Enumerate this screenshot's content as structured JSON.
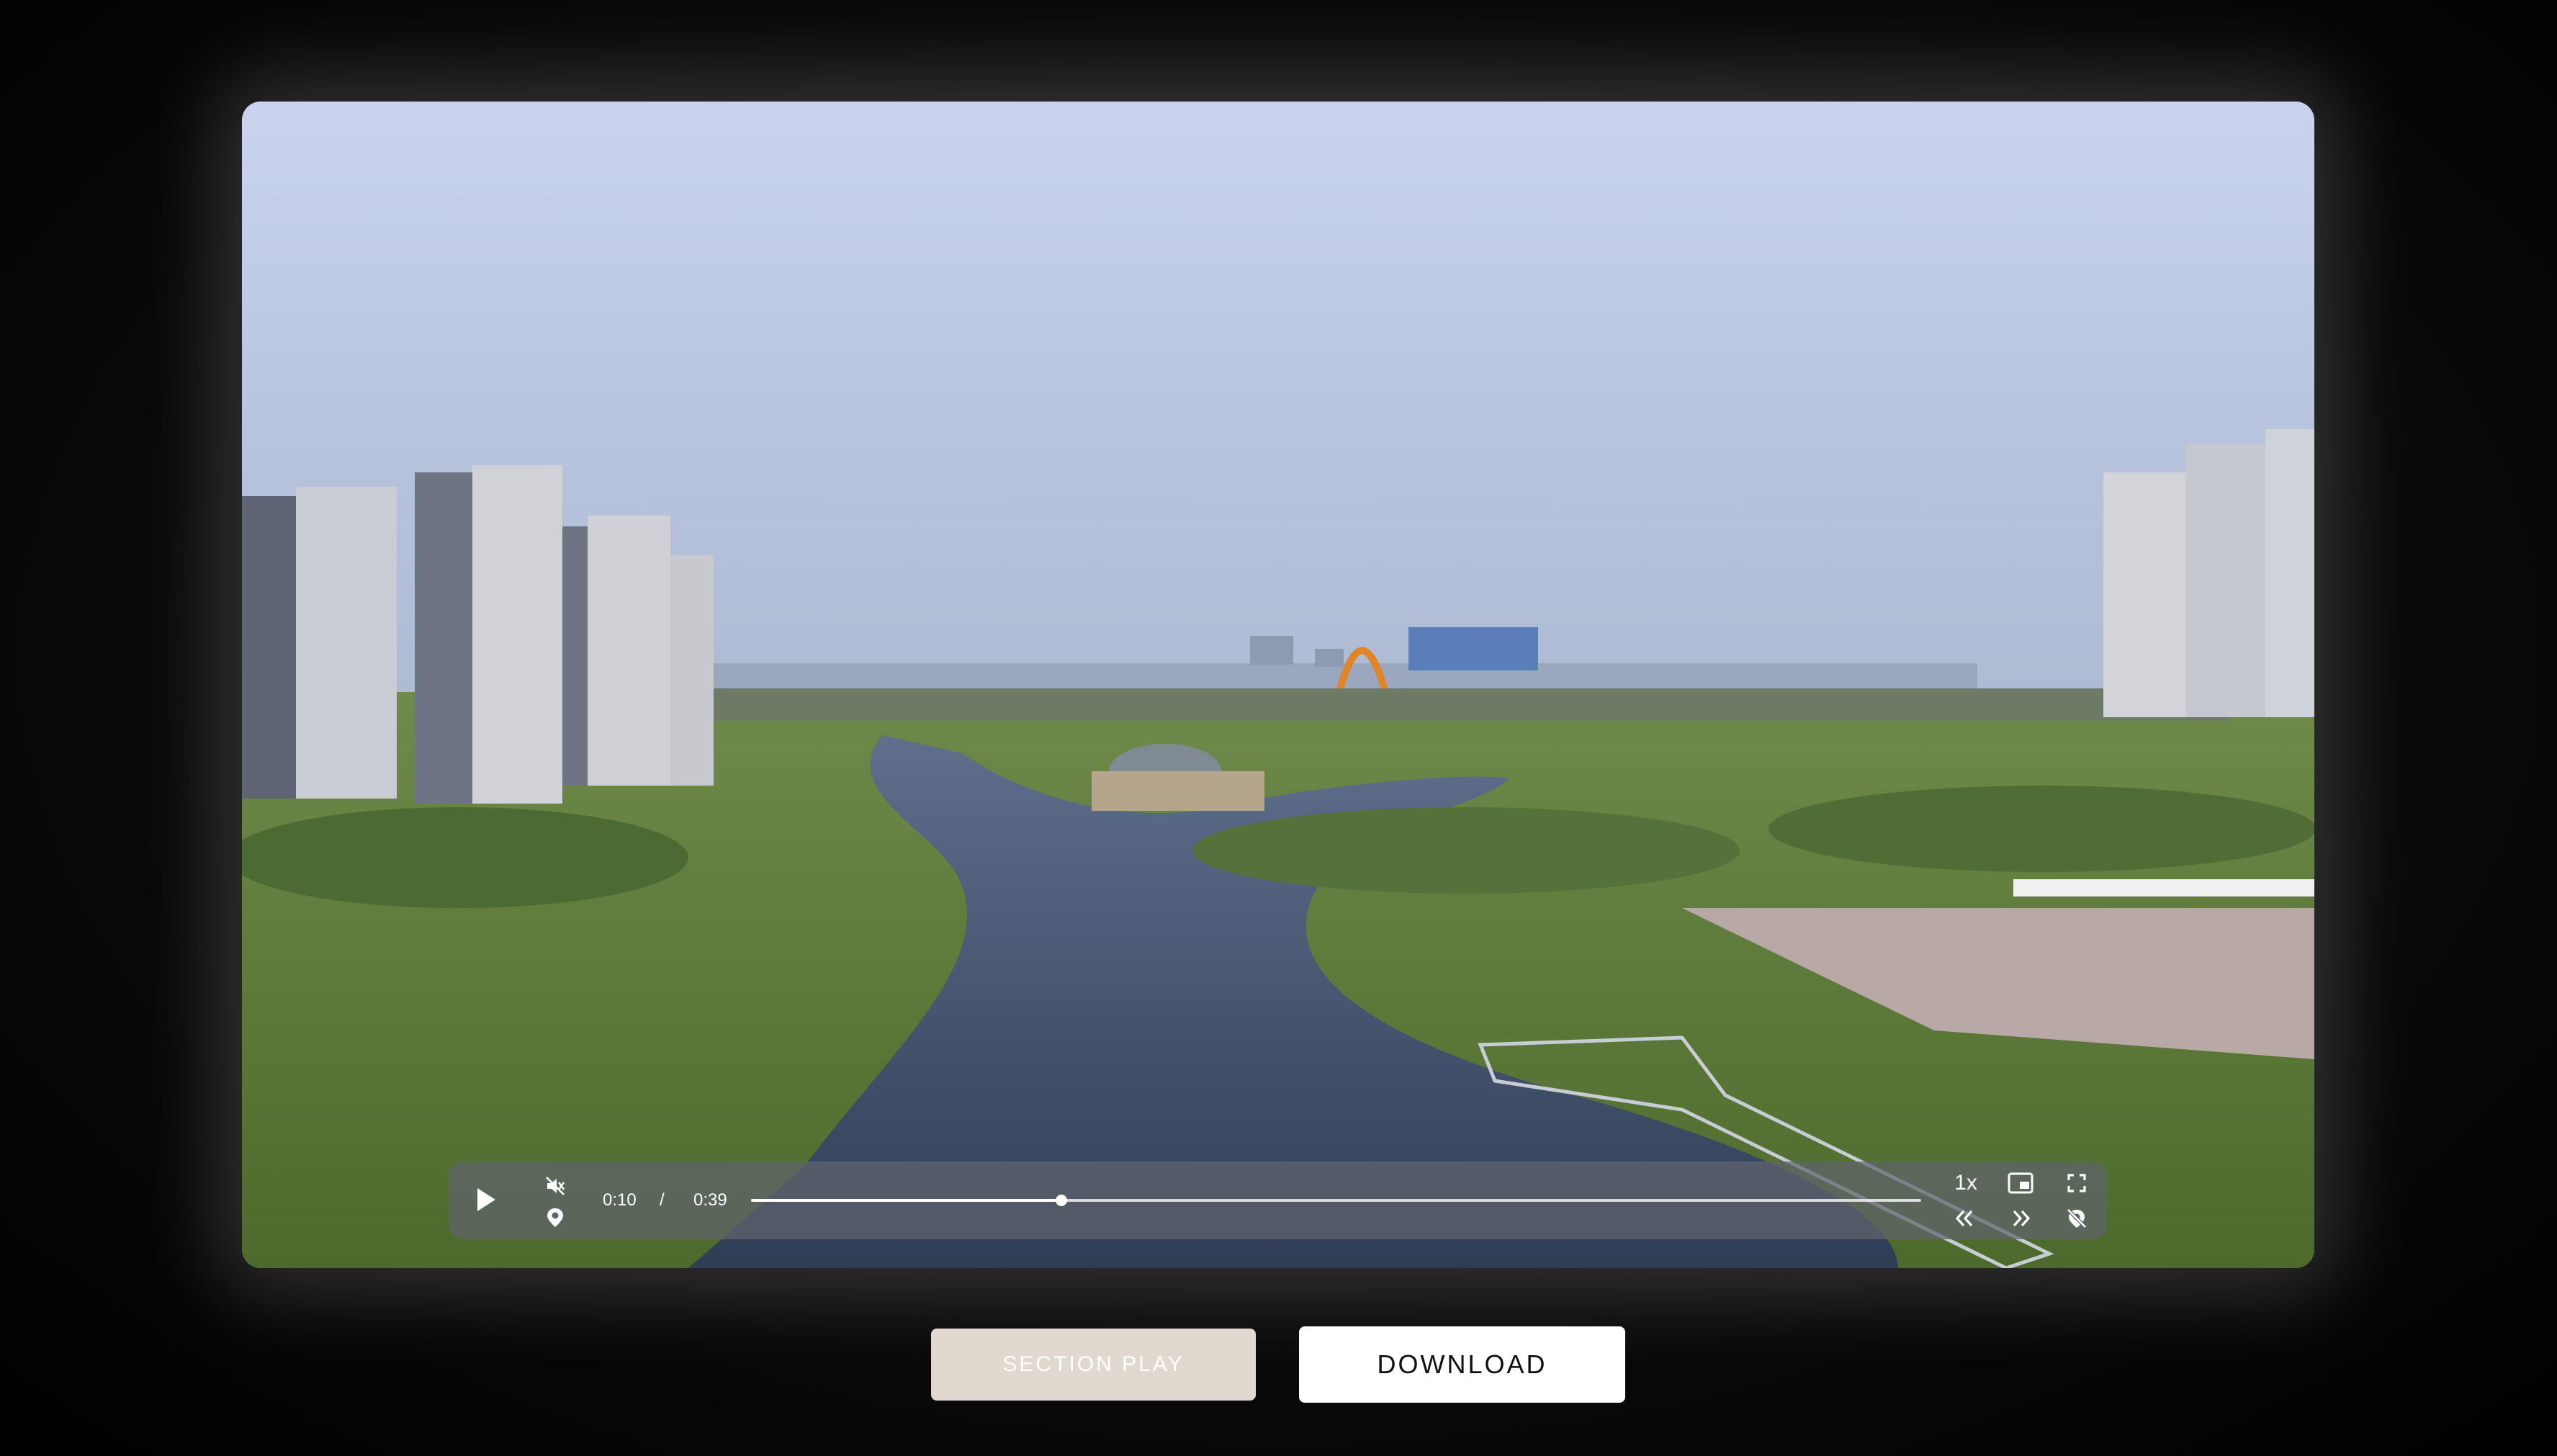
{
  "player": {
    "current_time": "0:10",
    "separator": "/",
    "duration": "0:39",
    "progress": 0.265,
    "speed_label": "1x",
    "icons": {
      "play": "play-icon",
      "mute": "volume-muted-icon",
      "location": "location-pin-icon",
      "pip": "picture-in-picture-icon",
      "fullscreen": "fullscreen-icon",
      "rewind": "rewind-icon",
      "forward": "fast-forward-icon",
      "location_off": "location-off-icon"
    }
  },
  "actions": {
    "section_play_label": "SECTION PLAY",
    "download_label": "DOWNLOAD"
  },
  "colors": {
    "section_play_bg": "#e1d9cf",
    "download_bg": "#ffffff",
    "control_bar_bg": "#60646c"
  }
}
